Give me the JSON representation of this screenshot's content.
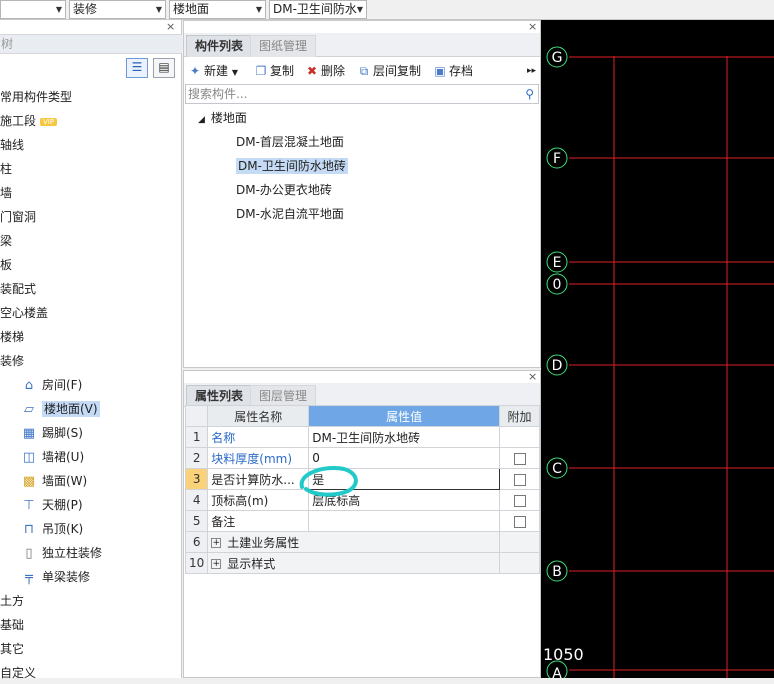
{
  "top_combos": [
    {
      "value": ""
    },
    {
      "value": "装修"
    },
    {
      "value": "楼地面"
    },
    {
      "value": "DM-卫生间防水"
    }
  ],
  "left_panel": {
    "header": "树",
    "vip_badge": "VIP",
    "tree": [
      {
        "label": "常用构件类型"
      },
      {
        "label": "施工段"
      },
      {
        "label": "轴线"
      },
      {
        "label": "柱"
      },
      {
        "label": "墙"
      },
      {
        "label": "门窗洞"
      },
      {
        "label": "梁"
      },
      {
        "label": "板"
      },
      {
        "label": "装配式"
      },
      {
        "label": "空心楼盖"
      },
      {
        "label": "楼梯"
      },
      {
        "label": "装修"
      }
    ],
    "sub_items": [
      {
        "label": "房间(F)",
        "icon": "room-icon"
      },
      {
        "label": "楼地面(V)",
        "icon": "floor-icon"
      },
      {
        "label": "踢脚(S)",
        "icon": "baseboard-icon"
      },
      {
        "label": "墙裙(U)",
        "icon": "dado-icon"
      },
      {
        "label": "墙面(W)",
        "icon": "wall-surface-icon"
      },
      {
        "label": "天棚(P)",
        "icon": "ceiling-icon"
      },
      {
        "label": "吊顶(K)",
        "icon": "suspended-ceiling-icon"
      },
      {
        "label": "独立柱装修",
        "icon": "column-finish-icon"
      },
      {
        "label": "单梁装修",
        "icon": "beam-finish-icon"
      }
    ],
    "tree_after": [
      {
        "label": "土方"
      },
      {
        "label": "基础"
      },
      {
        "label": "其它"
      },
      {
        "label": "自定义"
      }
    ]
  },
  "component_panel": {
    "tabs": [
      "构件列表",
      "图纸管理"
    ],
    "toolbar": {
      "new": "新建",
      "copy": "复制",
      "delete": "删除",
      "floor_copy": "层间复制",
      "save": "存档"
    },
    "search_placeholder": "搜索构件...",
    "tree_root": "楼地面",
    "items": [
      "DM-首层混凝土地面",
      "DM-卫生间防水地砖",
      "DM-办公更衣地砖",
      "DM-水泥自流平地面"
    ]
  },
  "property_panel": {
    "tabs": [
      "属性列表",
      "图层管理"
    ],
    "headers": {
      "name": "属性名称",
      "value": "属性值",
      "extra": "附加"
    },
    "rows": [
      {
        "num": "1",
        "name": "名称",
        "value": "DM-卫生间防水地砖"
      },
      {
        "num": "2",
        "name": "块料厚度(mm)",
        "value": "0"
      },
      {
        "num": "3",
        "name": "是否计算防水...",
        "value": "是"
      },
      {
        "num": "4",
        "name": "顶标高(m)",
        "value": "层底标高"
      },
      {
        "num": "5",
        "name": "备注",
        "value": ""
      },
      {
        "num": "6",
        "name": "土建业务属性",
        "value": ""
      },
      {
        "num": "10",
        "name": "显示样式",
        "value": ""
      }
    ]
  },
  "cad": {
    "axis_labels": [
      "G",
      "F",
      "E",
      "0",
      "D",
      "C",
      "B",
      "A"
    ],
    "dimension": "1050",
    "colors": {
      "grid": "#e0202a",
      "marker": "#3fe07a",
      "text": "#ffffff"
    }
  }
}
